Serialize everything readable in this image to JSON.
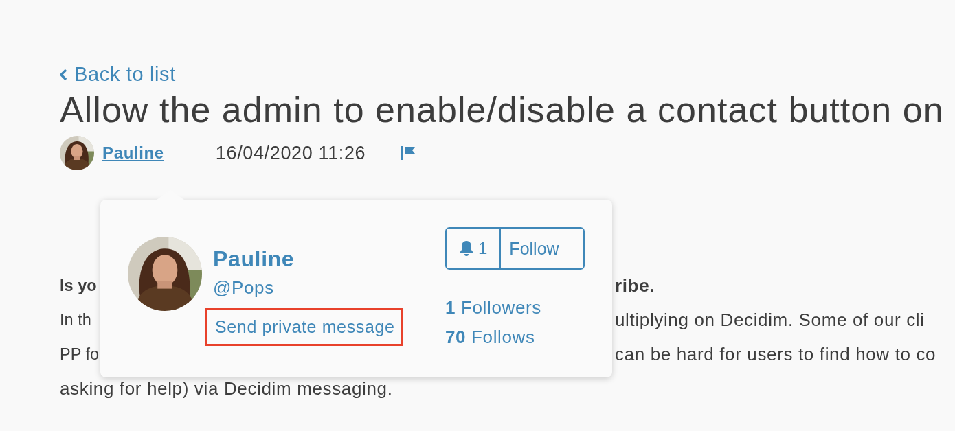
{
  "back_link": {
    "label": "Back to list"
  },
  "title": "Allow the admin to enable/disable a contact button on",
  "meta": {
    "author": "Pauline",
    "date": "16/04/2020 11:26"
  },
  "body": {
    "lines": [
      {
        "kind": "split",
        "bold": true,
        "left": "Is yo",
        "right": "ribe."
      },
      {
        "kind": "split",
        "bold": false,
        "left": "In th",
        "right": "ultiplying on Decidim. Some of our cli"
      },
      {
        "kind": "split",
        "bold": false,
        "left": "PP fo",
        "right": "can be hard for users to find how to co"
      },
      {
        "kind": "full",
        "bold": false,
        "text": "asking for help) via Decidim messaging."
      }
    ]
  },
  "profile_popup": {
    "name": "Pauline",
    "nickname": "@Pops",
    "message_link": {
      "label": "Send private message",
      "highlighted": true
    },
    "follow": {
      "count": "1",
      "label": "Follow"
    },
    "stats": [
      {
        "text": "**1** Followers"
      },
      {
        "text": "**70** Follows"
      }
    ]
  }
}
